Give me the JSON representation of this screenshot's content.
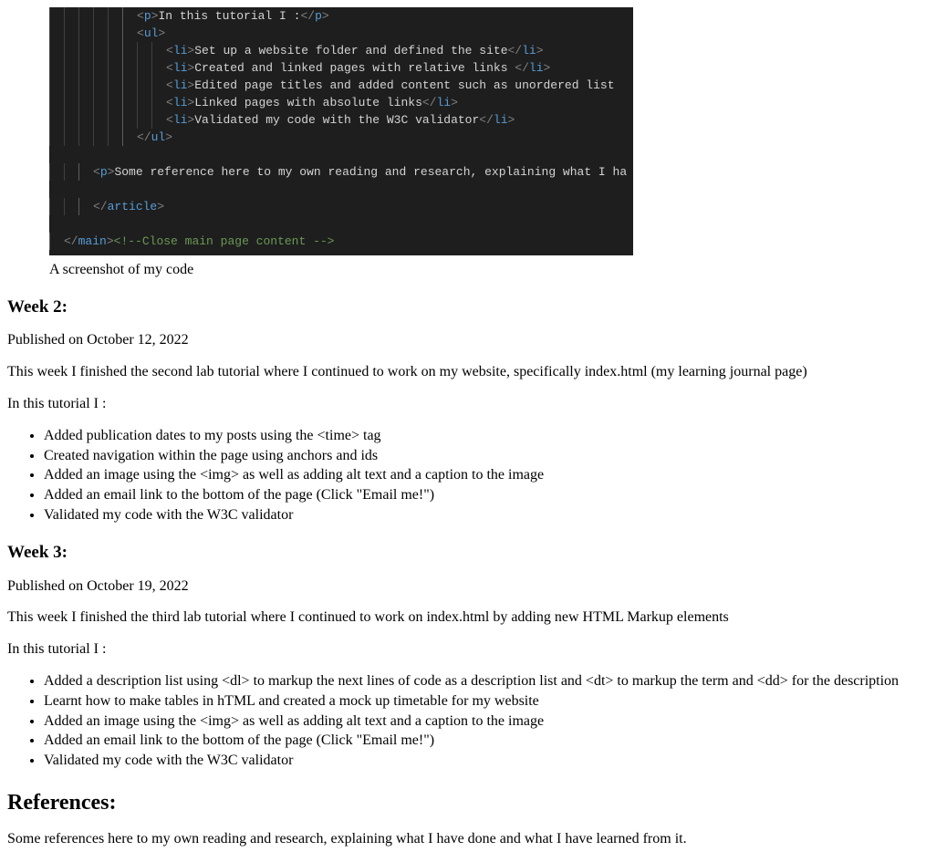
{
  "code_screenshot": {
    "lines": [
      {
        "indent": 6,
        "active": 5,
        "segments": [
          {
            "cls": "tok-punc",
            "t": "<"
          },
          {
            "cls": "tok-tag",
            "t": "p"
          },
          {
            "cls": "tok-punc",
            "t": ">"
          },
          {
            "cls": "tok-plain",
            "t": "In this tutorial I :"
          },
          {
            "cls": "tok-punc",
            "t": "</"
          },
          {
            "cls": "tok-tag",
            "t": "p"
          },
          {
            "cls": "tok-punc",
            "t": ">"
          }
        ]
      },
      {
        "indent": 6,
        "active": 5,
        "segments": [
          {
            "cls": "tok-punc",
            "t": "<"
          },
          {
            "cls": "tok-tag",
            "t": "ul"
          },
          {
            "cls": "tok-punc",
            "t": ">"
          }
        ]
      },
      {
        "indent": 8,
        "active": 5,
        "segments": [
          {
            "cls": "tok-punc",
            "t": "<"
          },
          {
            "cls": "tok-tag",
            "t": "li"
          },
          {
            "cls": "tok-punc",
            "t": ">"
          },
          {
            "cls": "tok-plain",
            "t": "Set up a website folder and defined the site"
          },
          {
            "cls": "tok-punc",
            "t": "</"
          },
          {
            "cls": "tok-tag",
            "t": "li"
          },
          {
            "cls": "tok-punc",
            "t": ">"
          }
        ]
      },
      {
        "indent": 8,
        "active": 5,
        "segments": [
          {
            "cls": "tok-punc",
            "t": "<"
          },
          {
            "cls": "tok-tag",
            "t": "li"
          },
          {
            "cls": "tok-punc",
            "t": ">"
          },
          {
            "cls": "tok-plain",
            "t": "Created and linked pages with relative links "
          },
          {
            "cls": "tok-punc",
            "t": "</"
          },
          {
            "cls": "tok-tag",
            "t": "li"
          },
          {
            "cls": "tok-punc",
            "t": ">"
          }
        ]
      },
      {
        "indent": 8,
        "active": 5,
        "segments": [
          {
            "cls": "tok-punc",
            "t": "<"
          },
          {
            "cls": "tok-tag",
            "t": "li"
          },
          {
            "cls": "tok-punc",
            "t": ">"
          },
          {
            "cls": "tok-plain",
            "t": "Edited page titles and added content such as unordered list"
          },
          {
            "cls": "tok-punc",
            "t": ""
          }
        ]
      },
      {
        "indent": 8,
        "active": 5,
        "segments": [
          {
            "cls": "tok-punc",
            "t": "<"
          },
          {
            "cls": "tok-tag",
            "t": "li"
          },
          {
            "cls": "tok-punc",
            "t": ">"
          },
          {
            "cls": "tok-plain",
            "t": "Linked pages with absolute links"
          },
          {
            "cls": "tok-punc",
            "t": "</"
          },
          {
            "cls": "tok-tag",
            "t": "li"
          },
          {
            "cls": "tok-punc",
            "t": ">"
          }
        ]
      },
      {
        "indent": 8,
        "active": 5,
        "segments": [
          {
            "cls": "tok-punc",
            "t": "<"
          },
          {
            "cls": "tok-tag",
            "t": "li"
          },
          {
            "cls": "tok-punc",
            "t": ">"
          },
          {
            "cls": "tok-plain",
            "t": "Validated my code with the W3C validator"
          },
          {
            "cls": "tok-punc",
            "t": "</"
          },
          {
            "cls": "tok-tag",
            "t": "li"
          },
          {
            "cls": "tok-punc",
            "t": ">"
          }
        ]
      },
      {
        "indent": 6,
        "active": 5,
        "segments": [
          {
            "cls": "tok-punc",
            "t": "</"
          },
          {
            "cls": "tok-tag",
            "t": "ul"
          },
          {
            "cls": "tok-punc",
            "t": ">"
          }
        ]
      },
      {
        "indent": 0,
        "active": 0,
        "blank": true,
        "segments": []
      },
      {
        "indent": 3,
        "active": 2,
        "segments": [
          {
            "cls": "tok-punc",
            "t": "<"
          },
          {
            "cls": "tok-tag",
            "t": "p"
          },
          {
            "cls": "tok-punc",
            "t": ">"
          },
          {
            "cls": "tok-plain",
            "t": "Some reference here to my own reading and research, explaining what I ha"
          }
        ]
      },
      {
        "indent": 0,
        "active": 0,
        "blank": true,
        "segments": []
      },
      {
        "indent": 3,
        "active": 2,
        "segments": [
          {
            "cls": "tok-punc",
            "t": "</"
          },
          {
            "cls": "tok-tag",
            "t": "article"
          },
          {
            "cls": "tok-punc",
            "t": ">"
          }
        ]
      },
      {
        "indent": 0,
        "active": 0,
        "blank": true,
        "segments": []
      },
      {
        "indent": 1,
        "active": 0,
        "segments": [
          {
            "cls": "tok-punc",
            "t": "</"
          },
          {
            "cls": "tok-tag",
            "t": "main"
          },
          {
            "cls": "tok-punc",
            "t": ">"
          },
          {
            "cls": "tok-comm",
            "t": "<!--Close main page content -->"
          }
        ]
      }
    ],
    "caption": "A screenshot of my code"
  },
  "week2": {
    "heading": "Week 2:",
    "published": "Published on October 12, 2022",
    "intro": "This week I finished the second lab tutorial where I continued to work on my website, specifically index.html (my learning journal page)",
    "lead": "In this tutorial I :",
    "items": [
      "Added publication dates to my posts using the <time> tag",
      "Created navigation within the page using anchors and ids",
      "Added an image using the <img> as well as adding alt text and a caption to the image",
      "Added an email link to the bottom of the page (Click \"Email me!\")",
      "Validated my code with the W3C validator"
    ]
  },
  "week3": {
    "heading": "Week 3:",
    "published": "Published on October 19, 2022",
    "intro": "This week I finished the third lab tutorial where I continued to work on index.html by adding new HTML Markup elements",
    "lead": "In this tutorial I :",
    "items": [
      "Added a description list using <dl> to markup the next lines of code as a description list and <dt> to markup the term and <dd> for the description",
      "Learnt how to make tables in hTML and created a mock up timetable for my website",
      "Added an image using the <img> as well as adding alt text and a caption to the image",
      "Added an email link to the bottom of the page (Click \"Email me!\")",
      "Validated my code with the W3C validator"
    ]
  },
  "references": {
    "heading": "References:",
    "text": "Some references here to my own reading and research, explaining what I have done and what I have learned from it."
  }
}
